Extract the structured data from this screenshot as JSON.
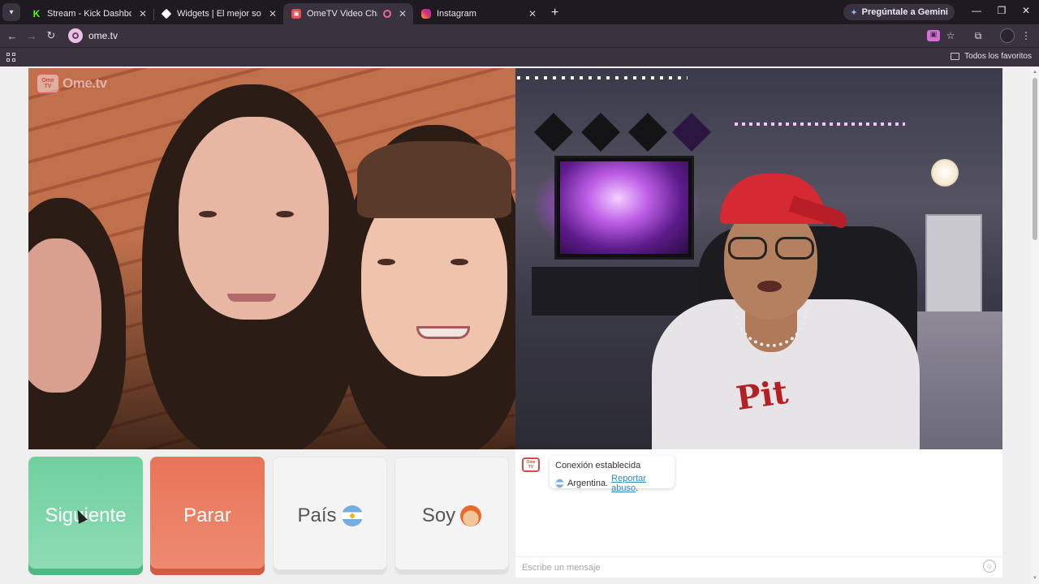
{
  "browser": {
    "tabs": [
      {
        "title": "Stream - Kick Dashboard",
        "favicon": "kick-icon",
        "active": false
      },
      {
        "title": "Widgets | El mejor software para",
        "favicon": "widgets-icon",
        "active": false
      },
      {
        "title": "OmeTV Video Chat — Ome",
        "favicon": "ometv-icon",
        "active": true
      },
      {
        "title": "Instagram",
        "favicon": "instagram-icon",
        "active": false
      }
    ],
    "gemini_label": "Pregúntale a Gemini",
    "url": "ome.tv",
    "bookmarks_label": "Todos los favoritos"
  },
  "page": {
    "logo_text": "Ome.tv",
    "logo_badge": "Ome TV",
    "buttons": {
      "next": "Siguiente",
      "stop": "Parar",
      "country": "País",
      "gender": "Soy"
    },
    "chat": {
      "status": "Conexión establecida",
      "country": "Argentina.",
      "report_link": "Reportar abuso",
      "report_suffix": ".",
      "input_placeholder": "Escribe un mensaje"
    },
    "shirt_text": "Pit"
  },
  "colors": {
    "next": "#6fd19f",
    "stop": "#e87458",
    "accent_link": "#2d8ac9",
    "chrome_dark": "#1f1a22",
    "chrome_mid": "#3b3240"
  }
}
